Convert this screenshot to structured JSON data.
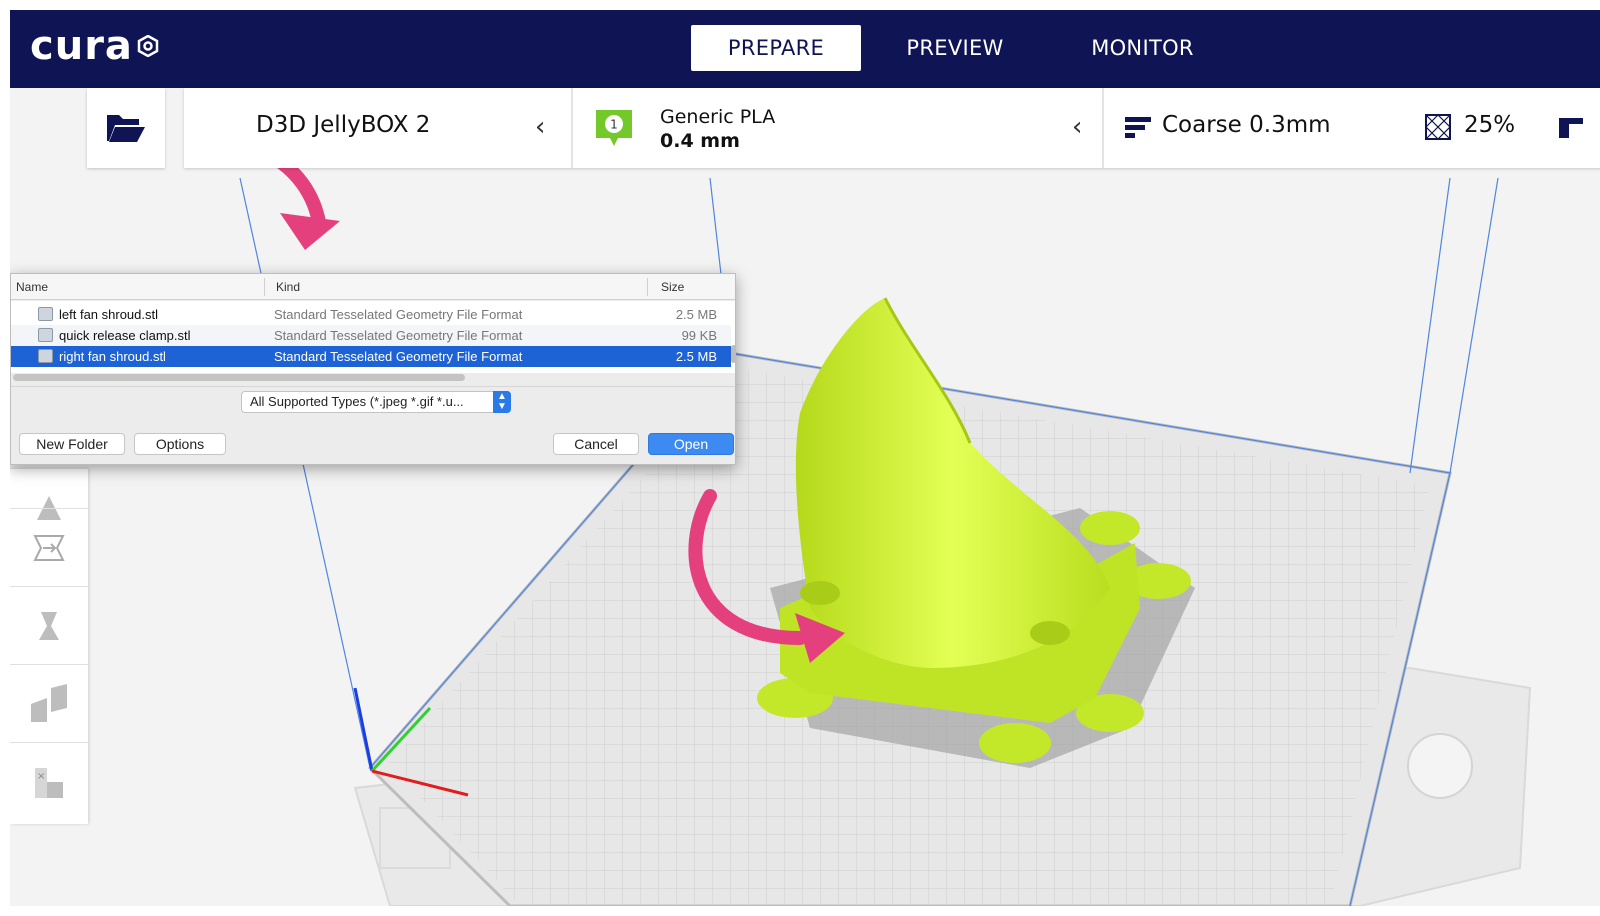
{
  "header": {
    "logo_text": "cura",
    "tabs": [
      {
        "label": "PREPARE",
        "active": true
      },
      {
        "label": "PREVIEW",
        "active": false
      },
      {
        "label": "MONITOR",
        "active": false
      }
    ]
  },
  "toolbar": {
    "printer_name": "D3D JellyBOX 2",
    "material_extruder": "1",
    "material_name": "Generic PLA",
    "material_size": "0.4 mm",
    "profile_name": "Coarse 0.3mm",
    "infill": "25%"
  },
  "dialog": {
    "columns": {
      "name": "Name",
      "kind": "Kind",
      "size": "Size"
    },
    "files": [
      {
        "name": "left fan shroud.stl",
        "kind": "Standard Tesselated Geometry File Format",
        "size": "2.5 MB",
        "selected": false
      },
      {
        "name": "quick release clamp.stl",
        "kind": "Standard Tesselated Geometry File Format",
        "size": "99 KB",
        "selected": false
      },
      {
        "name": "right fan shroud.stl",
        "kind": "Standard Tesselated Geometry File Format",
        "size": "2.5 MB",
        "selected": true
      }
    ],
    "file_type": "All Supported Types (*.jpeg *.gif *.u...",
    "buttons": {
      "new_folder": "New Folder",
      "options": "Options",
      "cancel": "Cancel",
      "open": "Open"
    }
  },
  "colors": {
    "header_bg": "#0f1454",
    "accent_arrow": "#e4407e",
    "model": "#cdf233",
    "material_badge": "#74c82a",
    "selection": "#1d63d6"
  },
  "icons": [
    "open-folder-icon",
    "cura-logo-icon",
    "chevron-left-icon",
    "material-badge-icon",
    "profile-bars-icon",
    "infill-icon",
    "support-icon",
    "move-tool-icon",
    "scale-tool-icon",
    "rotate-tool-icon",
    "mirror-tool-icon",
    "per-model-settings-icon"
  ]
}
